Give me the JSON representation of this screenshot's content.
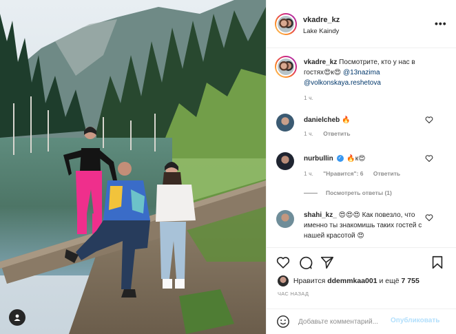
{
  "header": {
    "username": "vkadre_kz",
    "location": "Lake Kaindy",
    "more_label": "•••"
  },
  "caption": {
    "username": "vkadre_kz",
    "text": "Посмотрите, кто у нас в гостях😍к😍",
    "mention1": "@13nazima",
    "mention2": "@volkonskaya.reshetova",
    "time": "1 ч."
  },
  "comments": [
    {
      "username": "danielcheb",
      "text": "🔥",
      "time": "1 ч.",
      "reply_label": "Ответить"
    },
    {
      "username": "nurbullin",
      "text": "🔥к😍",
      "time": "1 ч.",
      "likes_label": "\"Нравится\": 6",
      "reply_label": "Ответить",
      "view_replies": "Посмотреть ответы (1)"
    },
    {
      "username": "shahi_kz_",
      "text": "😍😍😍 Как повезло, что именно ты знакомишь таких гостей с нашей красотой 😍"
    }
  ],
  "likes": {
    "prefix": "Нравится",
    "user": "ddemmkaa001",
    "suffix": "и ещё",
    "count": "7 755"
  },
  "timestamp": "ЧАС НАЗАД",
  "add_comment": {
    "placeholder": "Добавьте комментарий...",
    "publish_label": "Опубликовать"
  },
  "colors": {
    "link": "#00376b",
    "verified": "#3897f0",
    "publish_disabled": "#b2dffc",
    "secondary_text": "#8e8e8e"
  },
  "icons": [
    "tag-user-icon",
    "more-options-icon",
    "heart-icon",
    "comment-icon",
    "share-icon",
    "bookmark-icon",
    "emoji-icon",
    "verified-icon"
  ]
}
